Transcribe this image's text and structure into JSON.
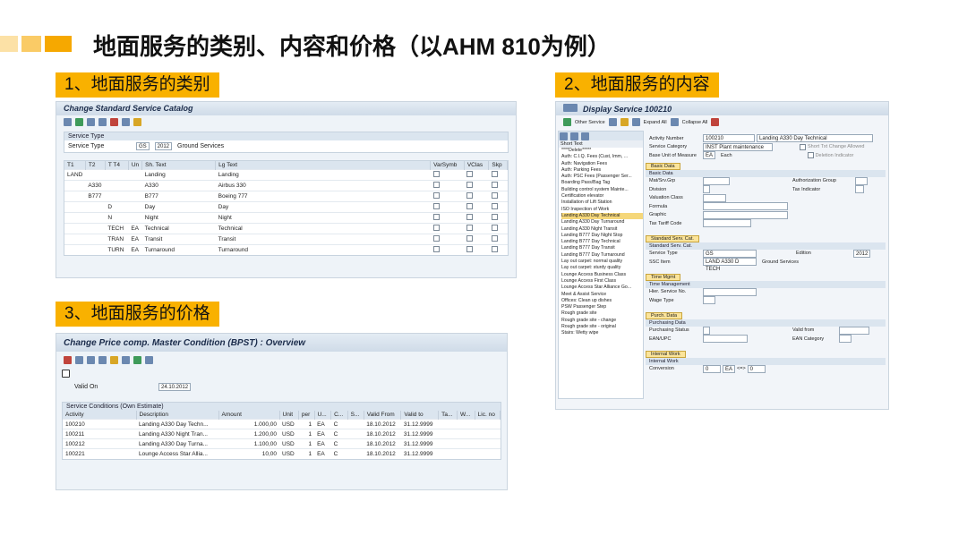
{
  "title": "地面服务的类别、内容和价格（以AHM 810为例）",
  "colors": {
    "accent": "#f6a800",
    "label_bg": "#f9b100"
  },
  "sections": {
    "s1": "1、地面服务的类别",
    "s2": "2、地面服务的内容",
    "s3": "3、地面服务的价格"
  },
  "shot1": {
    "title": "Change Standard Service Catalog",
    "group": "Service Type",
    "field_label": "Service Type",
    "field_value": "GS",
    "field_year": "2012",
    "field_desc": "Ground Services",
    "columns": [
      "T1",
      "T2",
      "T T4",
      "Un",
      "Sh. Text",
      "Lg Text",
      "VarSymb",
      "VClas",
      "Skp"
    ],
    "rows": [
      {
        "t1": "LAND",
        "t2": "",
        "t3": "",
        "un": "",
        "sh": "Landing",
        "lg": "Landing"
      },
      {
        "t1": "",
        "t2": "A330",
        "t3": "",
        "un": "",
        "sh": "A330",
        "lg": "Airbus 330"
      },
      {
        "t1": "",
        "t2": "B777",
        "t3": "",
        "un": "",
        "sh": "B777",
        "lg": "Boeing 777"
      },
      {
        "t1": "",
        "t2": "",
        "t3": "D",
        "un": "",
        "sh": "Day",
        "lg": "Day"
      },
      {
        "t1": "",
        "t2": "",
        "t3": "N",
        "un": "",
        "sh": "Night",
        "lg": "Night"
      },
      {
        "t1": "",
        "t2": "",
        "t3": "TECH",
        "un": "EA",
        "sh": "Technical",
        "lg": "Technical"
      },
      {
        "t1": "",
        "t2": "",
        "t3": "TRAN",
        "un": "EA",
        "sh": "Transit",
        "lg": "Transit"
      },
      {
        "t1": "",
        "t2": "",
        "t3": "TURN",
        "un": "EA",
        "sh": "Turnaround",
        "lg": "Turnaround"
      }
    ]
  },
  "shot2": {
    "title": "Display Service 100210",
    "toolbar": [
      "Other Service",
      "Expand All",
      "Collapse All"
    ],
    "tree_header": "Short Text",
    "tree": [
      "****Delete*****",
      "Auth: C.I.Q. Fees (Cust, Imm, ...",
      "Auth: Navigation Fees",
      "Auth: Parking Fees",
      "Auth: PSC Fees (Passenger Ser...",
      "Boarding Pass/Bag Tag",
      "Building control system Mainte...",
      "Certification elevator",
      "Installation of Lift Station",
      "ISO Inspection of Work",
      "Landing A330 Day Technical",
      "Landing A330 Day Turnaround",
      "Landing A330 Night Transit",
      "Landing B777 Day Night Stop",
      "Landing B777 Day Technical",
      "Landing B777 Day Transit",
      "Landing B777 Day Turnaround",
      "Lay out carpet: normal quality",
      "Lay out carpet: sturdy quality",
      "Lounge Access Business Class",
      "Lounge Access First Class",
      "Lounge Access Star Alliance Go...",
      "Meet & Assist Service",
      "Offices: Clean up dishes",
      "PSW Passenger Step",
      "Rough grade site",
      "Rough grade site - change",
      "Rough grade site - original",
      "Stairs: Wetty wipe"
    ],
    "activity_label": "Activity Number",
    "activity_value": "100210",
    "activity_desc": "Landing A330 Day Technical",
    "category_label": "Service Category",
    "category_value": "INST Plant maintenance",
    "short_txt": "Short Txt Change Allowed",
    "deletion": "Deletion Indicator",
    "uom_label": "Base Unit of Measure",
    "uom_value": "EA",
    "uom_desc": "Each",
    "basic_btn": "Basic Data",
    "basic_head": "Basic Data",
    "basic_fields": [
      "Mat/Srv.Grp",
      "Division",
      "Valuation Class",
      "Formula",
      "Graphic",
      "Tax Tariff Code"
    ],
    "auth_group": "Authorization Group",
    "tax_ind": "Tax Indicator",
    "std_btn": "Standard Serv. Cat.",
    "std_head": "Standard Serv. Cat.",
    "svc_type_label": "Service Type",
    "svc_type_value": "GS",
    "edition_label": "Edition",
    "edition_value": "2012",
    "ssc_label": "SSC Item",
    "ssc_value": "LAND A330 D TECH",
    "ssc_desc": "Ground Services",
    "time_btn": "Time Mgmt",
    "time_head": "Time Management",
    "hier_label": "Hier. Service No.",
    "wage_label": "Wage Type",
    "purch_btn": "Purch. Data",
    "purch_head": "Purchasing Data",
    "purch_status": "Purchasing Status",
    "ean": "EAN/UPC",
    "valid_from": "Valid from",
    "ean_cat": "EAN Category",
    "int_btn": "Internal Work",
    "int_head": "Internal Work",
    "conversion_label": "Conversion",
    "conv1": "0",
    "conv_unit": "EA",
    "conv_arrow": "<=>",
    "conv2": "0"
  },
  "shot3": {
    "title": "Change Price comp. Master Condition (BPST) : Overview",
    "valid_label": "Valid On",
    "valid_value": "24.10.2012",
    "group": "Service Conditions (Own Estimate)",
    "columns": [
      "Activity",
      "Description",
      "Amount",
      "Unit",
      "per",
      "U...",
      "C...",
      "S...",
      "Valid From",
      "Valid to",
      "Ta...",
      "W...",
      "Lic. no"
    ],
    "rows": [
      {
        "act": "100210",
        "desc": "Landing A330 Day Techn...",
        "amt": "1.000,00",
        "unit": "USD",
        "per": "1",
        "u": "EA",
        "c": "C",
        "from": "18.10.2012",
        "to": "31.12.9999"
      },
      {
        "act": "100211",
        "desc": "Landing A330 Night Tran...",
        "amt": "1.200,00",
        "unit": "USD",
        "per": "1",
        "u": "EA",
        "c": "C",
        "from": "18.10.2012",
        "to": "31.12.9999"
      },
      {
        "act": "100212",
        "desc": "Landing A330 Day Turna...",
        "amt": "1.100,00",
        "unit": "USD",
        "per": "1",
        "u": "EA",
        "c": "C",
        "from": "18.10.2012",
        "to": "31.12.9999"
      },
      {
        "act": "100221",
        "desc": "Lounge Access Star Allia...",
        "amt": "10,00",
        "unit": "USD",
        "per": "1",
        "u": "EA",
        "c": "C",
        "from": "18.10.2012",
        "to": "31.12.9999"
      }
    ]
  }
}
